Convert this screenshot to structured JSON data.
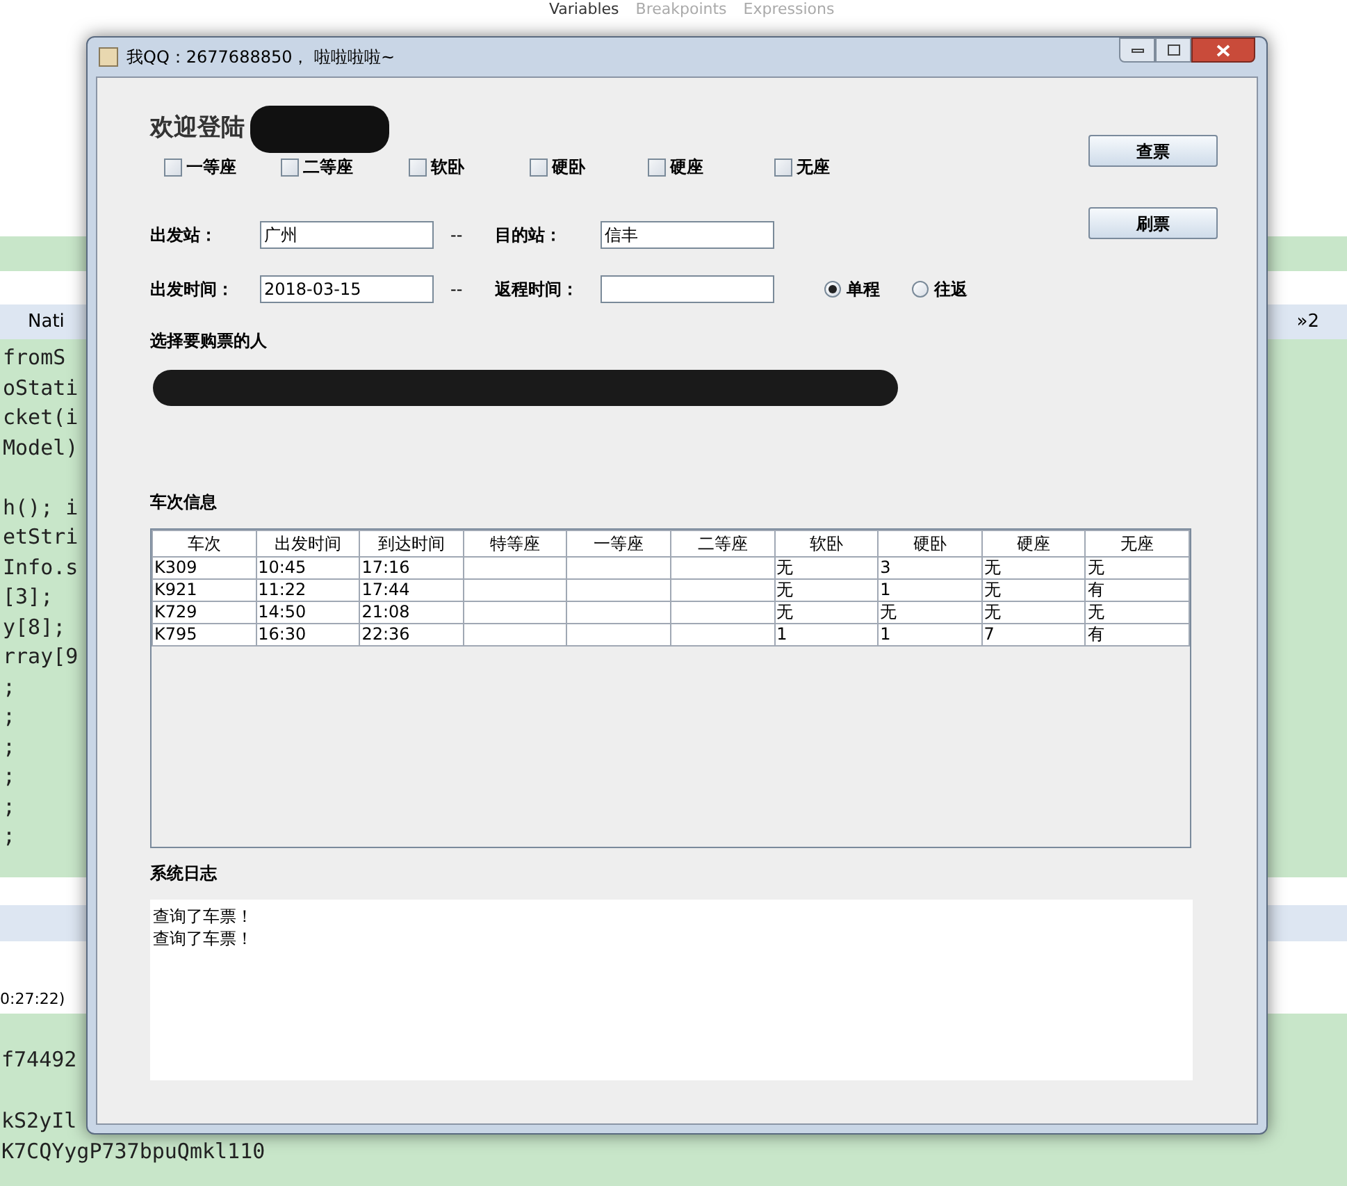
{
  "ide": {
    "view_tabs": [
      {
        "label": "Variables"
      },
      {
        "label": "Breakpoints"
      },
      {
        "label": "Expressions"
      }
    ],
    "editor_tab": "Nati",
    "overflow": "»2",
    "code_blocks": [
      [
        "fromS",
        "oStati",
        "cket(i",
        "Model)"
      ],
      [
        "h(); i",
        "etStri",
        "Info.s",
        "[3];",
        "y[8];",
        "rray[9",
        ";",
        ";",
        ";",
        ";",
        ";",
        ";"
      ]
    ],
    "console_time": "0:27:22)",
    "console_blocks": [
      [
        "f74492"
      ],
      [
        "kS2yIl",
        "K7CQYygP737bpuQmkl110"
      ]
    ]
  },
  "window": {
    "title": "我QQ：2677688850， 啦啦啦啦~"
  },
  "welcome": "欢迎登陆",
  "seat_options": [
    {
      "label": "一等座",
      "checked": false
    },
    {
      "label": "二等座",
      "checked": false
    },
    {
      "label": "软卧",
      "checked": false
    },
    {
      "label": "硬卧",
      "checked": false
    },
    {
      "label": "硬座",
      "checked": false
    },
    {
      "label": "无座",
      "checked": false
    }
  ],
  "buttons": [
    "查票",
    "刷票"
  ],
  "stations": {
    "from_label": "出发站：",
    "from_value": "广州",
    "separator": "--",
    "to_label": "目的站：",
    "to_value": "信丰"
  },
  "dates": {
    "depart_label": "出发时间：",
    "depart_value": "2018-03-15",
    "separator": "--",
    "return_label": "返程时间："
  },
  "trip_types": [
    {
      "label": "单程",
      "selected": true
    },
    {
      "label": "往返",
      "selected": false
    }
  ],
  "passengers_label": "选择要购票的人",
  "trains_label": "车次信息",
  "table": {
    "columns": [
      "车次",
      "出发时间",
      "到达时间",
      "特等座",
      "一等座",
      "二等座",
      "软卧",
      "硬卧",
      "硬座",
      "无座"
    ],
    "rows": [
      [
        "K309",
        "10:45",
        "17:16",
        "",
        "",
        "",
        "无",
        "3",
        "无",
        "无"
      ],
      [
        "K921",
        "11:22",
        "17:44",
        "",
        "",
        "",
        "无",
        "1",
        "无",
        "有"
      ],
      [
        "K729",
        "14:50",
        "21:08",
        "",
        "",
        "",
        "无",
        "无",
        "无",
        "无"
      ],
      [
        "K795",
        "16:30",
        "22:36",
        "",
        "",
        "",
        "1",
        "1",
        "7",
        "有"
      ]
    ]
  },
  "log_label": "系统日志",
  "log_lines": [
    "查询了车票！",
    "查询了车票！"
  ]
}
